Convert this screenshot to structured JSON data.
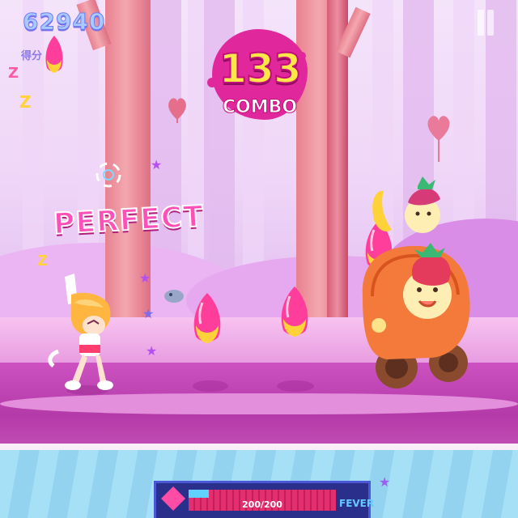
{
  "hud": {
    "score": "62940",
    "score_label": "得分",
    "combo_number": "133",
    "combo_label": "COMBO",
    "judgement": "PERFECT"
  },
  "fever_bar": {
    "hp_text": "200/200",
    "label": "FEVER",
    "fever_progress": 0.14
  },
  "icons": {
    "pause": "pause-icon",
    "fever_badge": "heart-badge-icon",
    "note": "candy-note-icon",
    "target": "hit-target-icon"
  },
  "colors": {
    "combo_blob": "#e0279b",
    "combo_number": "#ffe74a",
    "judgement": "#ff4fb8",
    "note_pink": "#ff3d9a",
    "note_yellow": "#ffd23a",
    "fever_track": "#e32f6f",
    "fever_fill": "#5fd0ff"
  }
}
